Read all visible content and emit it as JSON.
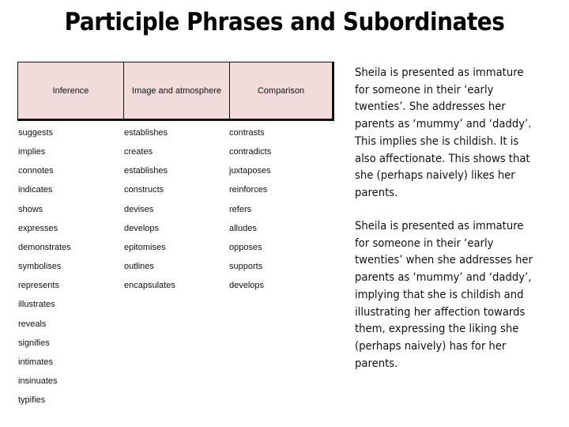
{
  "title": "Participle Phrases and Subordinates",
  "table": {
    "headers": [
      "Inference",
      "Image and atmosphere",
      "Comparison"
    ],
    "columns": {
      "inference": [
        "suggests",
        "implies",
        "connotes",
        "indicates",
        "shows",
        "expresses",
        "demonstrates",
        "symbolises",
        "represents",
        "illustrates",
        "reveals",
        "signifies",
        "intimates",
        "insinuates",
        "typifies"
      ],
      "image_and_atmosphere": [
        "establishes",
        "creates",
        "establishes",
        "constructs",
        "devises",
        "develops",
        "epitomises",
        "outlines",
        "encapsulates"
      ],
      "comparison": [
        "contrasts",
        "contradicts",
        "juxtaposes",
        "reinforces",
        "refers",
        "alludes",
        "opposes",
        "supports",
        "develops"
      ]
    },
    "header_fill": "#f2dcdb"
  },
  "paragraphs": [
    {
      "lines": [
        "Sheila is presented as immature",
        "for someone in their ‘early",
        "twenties’. She addresses her",
        "parents as ‘mummy’ and ‘daddy’.",
        "This implies she is childish. It is",
        "also affectionate. This shows that",
        "she (perhaps naively) likes her",
        "parents."
      ]
    },
    {
      "lines": [
        "Sheila is presented as immature",
        "for someone in their ‘early",
        "twenties’ when she addresses her",
        "parents as ‘mummy’ and ‘daddy’,",
        "implying that she is childish and",
        "illustrating her affection towards",
        "them, expressing the liking she",
        "(perhaps naively) has for her",
        "parents."
      ]
    }
  ]
}
